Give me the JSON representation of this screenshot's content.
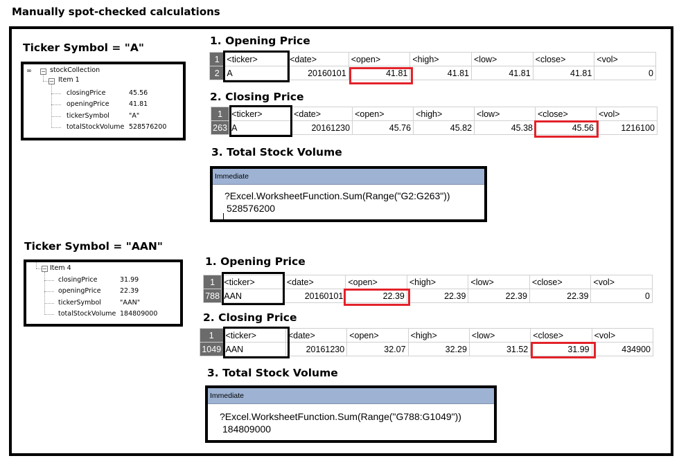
{
  "page_title": "Manually spot-checked calculations",
  "sections": [
    {
      "ticker_heading": "Ticker Symbol = \"A\"",
      "tree": {
        "root_label": "stockCollection",
        "item_label": "Item 1",
        "fields": [
          {
            "name": "closingPrice",
            "value": "45.56"
          },
          {
            "name": "openingPrice",
            "value": "41.81"
          },
          {
            "name": "tickerSymbol",
            "value": "\"A\""
          },
          {
            "name": "totalStockVolume",
            "value": "528576200"
          }
        ]
      },
      "opening_heading": "1. Opening Price",
      "opening_table": {
        "header_row_num": "1",
        "data_row_num": "2",
        "columns": [
          "<ticker>",
          "<date>",
          "<open>",
          "<high>",
          "<low>",
          "<close>",
          "<vol>"
        ],
        "values": [
          "A",
          "20160101",
          "41.81",
          "41.81",
          "41.81",
          "41.81",
          "0"
        ]
      },
      "closing_heading": "2. Closing Price",
      "closing_table": {
        "header_row_num": "1",
        "data_row_num": "263",
        "columns": [
          "<ticker>",
          "<date>",
          "<open>",
          "<high>",
          "<low>",
          "<close>",
          "<vol>"
        ],
        "values": [
          "A",
          "20161230",
          "45.76",
          "45.82",
          "45.38",
          "45.56",
          "1216100"
        ]
      },
      "volume_heading": "3. Total Stock Volume",
      "immediate": {
        "title": "Immediate",
        "command": "?Excel.WorksheetFunction.Sum(Range(\"G2:G263\"))",
        "result": "528576200"
      }
    },
    {
      "ticker_heading": "Ticker Symbol = \"AAN\"",
      "tree": {
        "item_label": "Item 4",
        "fields": [
          {
            "name": "closingPrice",
            "value": "31.99"
          },
          {
            "name": "openingPrice",
            "value": "22.39"
          },
          {
            "name": "tickerSymbol",
            "value": "\"AAN\""
          },
          {
            "name": "totalStockVolume",
            "value": "184809000"
          }
        ]
      },
      "opening_heading": "1. Opening Price",
      "opening_table": {
        "header_row_num": "1",
        "data_row_num": "788",
        "columns": [
          "<ticker>",
          "<date>",
          "<open>",
          "<high>",
          "<low>",
          "<close>",
          "<vol>"
        ],
        "values": [
          "AAN",
          "20160101",
          "22.39",
          "22.39",
          "22.39",
          "22.39",
          "0"
        ]
      },
      "closing_heading": "2. Closing Price",
      "closing_table": {
        "header_row_num": "1",
        "data_row_num": "1049",
        "columns": [
          "<ticker>",
          "<date>",
          "<open>",
          "<high>",
          "<low>",
          "<close>",
          "<vol>"
        ],
        "values": [
          "AAN",
          "20161230",
          "32.07",
          "32.29",
          "31.52",
          "31.99",
          "434900"
        ]
      },
      "volume_heading": "3. Total Stock Volume",
      "immediate": {
        "title": "Immediate",
        "command": "?Excel.WorksheetFunction.Sum(Range(\"G788:G1049\"))",
        "result": "184809000"
      }
    }
  ],
  "colors": {
    "highlight_red": "#e3222a",
    "row_header_bg": "#6b6b6b",
    "immediate_titlebar": "#9eb3d4"
  }
}
